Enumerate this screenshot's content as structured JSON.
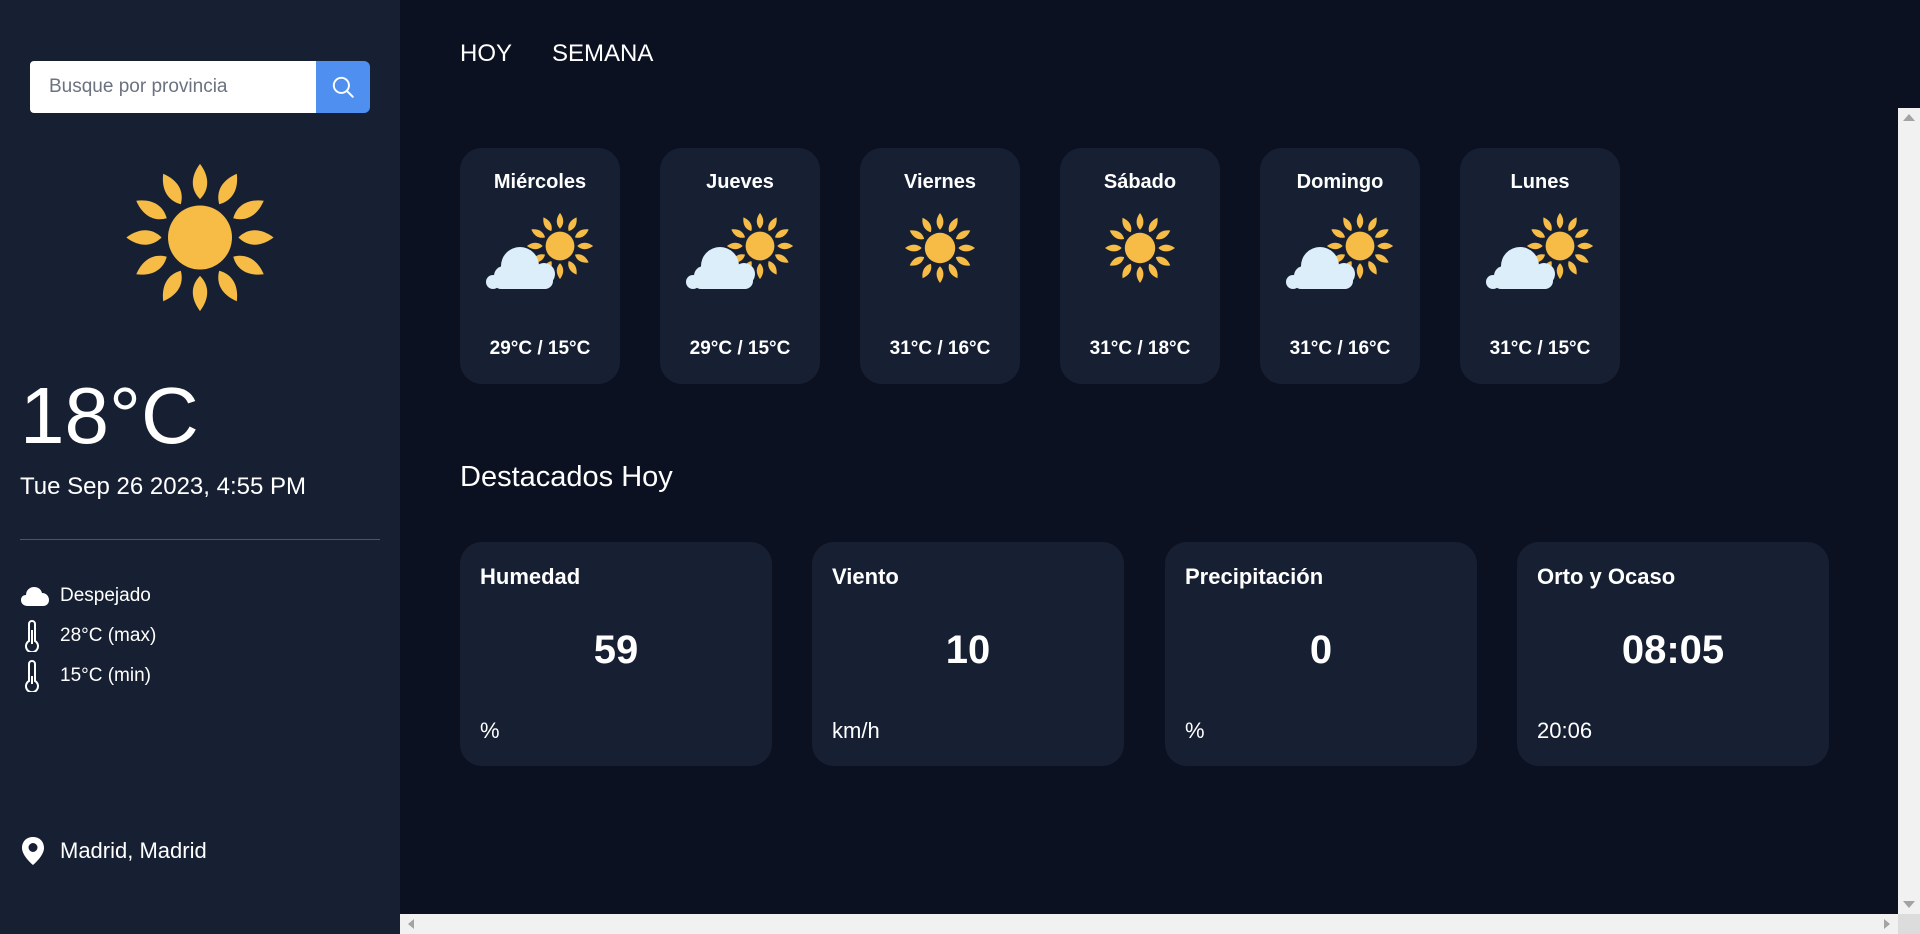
{
  "search": {
    "placeholder": "Busque por provincia",
    "value": ""
  },
  "current": {
    "icon": "sun-icon",
    "temperature": "18°C",
    "datetime": "Tue Sep 26 2023, 4:55 PM",
    "condition": "Despejado",
    "max": "28°C (max)",
    "min": "15°C (min)",
    "location": "Madrid, Madrid"
  },
  "tabs": [
    {
      "label": "HOY"
    },
    {
      "label": "SEMANA"
    }
  ],
  "forecast": [
    {
      "day": "Miércoles",
      "icon": "sun-behind-cloud-icon",
      "temps": "29°C / 15°C"
    },
    {
      "day": "Jueves",
      "icon": "sun-behind-cloud-icon",
      "temps": "29°C / 15°C"
    },
    {
      "day": "Viernes",
      "icon": "sun-icon",
      "temps": "31°C / 16°C"
    },
    {
      "day": "Sábado",
      "icon": "sun-icon",
      "temps": "31°C / 18°C"
    },
    {
      "day": "Domingo",
      "icon": "sun-behind-cloud-icon",
      "temps": "31°C / 16°C"
    },
    {
      "day": "Lunes",
      "icon": "sun-behind-cloud-icon",
      "temps": "31°C / 15°C"
    }
  ],
  "highlights": {
    "title": "Destacados Hoy",
    "items": [
      {
        "title": "Humedad",
        "value": "59",
        "unit": "%"
      },
      {
        "title": "Viento",
        "value": "10",
        "unit": "km/h"
      },
      {
        "title": "Precipitación",
        "value": "0",
        "unit": "%"
      },
      {
        "title": "Orto y Ocaso",
        "value": "08:05",
        "unit": "20:06"
      }
    ]
  },
  "colors": {
    "sidebar_bg": "#172033",
    "main_bg": "#0b1120",
    "card_bg": "#172033",
    "accent": "#4f8ff0",
    "sun": "#f6bc45",
    "cloud": "#dbeefa"
  }
}
